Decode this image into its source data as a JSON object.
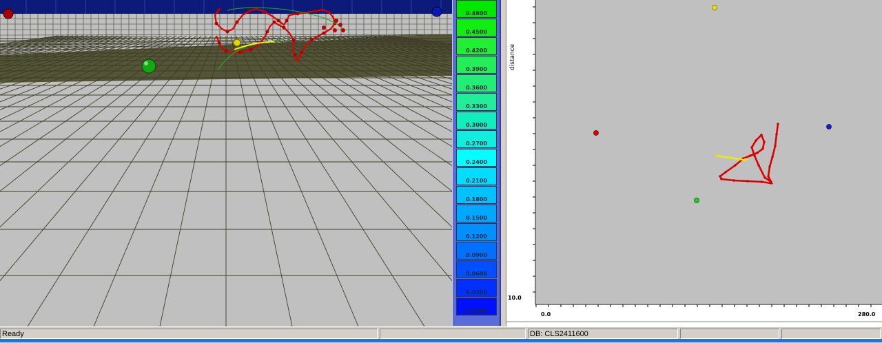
{
  "colors": {
    "sky": "#0c1a7a",
    "floor": "#c0c0c0",
    "back_floor": "#545437",
    "grid": "#3d3d28",
    "track_red": "#dd0000",
    "track_yellow": "#f2f200",
    "track_green": "#22aa22",
    "plot_bg": "#c0c0c0"
  },
  "color_scale": {
    "labels": [
      "0.4800",
      "0.4500",
      "0.4200",
      "0.3900",
      "0.3600",
      "0.3300",
      "0.3000",
      "0.2700",
      "0.2400",
      "0.2100",
      "0.1800",
      "0.1500",
      "0.1200",
      "0.0900",
      "0.0600",
      "0.0300",
      "0.0000"
    ],
    "colors": [
      "#00e800",
      "#11ee11",
      "#22ee33",
      "#22ee55",
      "#22ee77",
      "#22ee99",
      "#11eebb",
      "#11eedd",
      "#00ffff",
      "#00ddff",
      "#00c2ff",
      "#00a8ff",
      "#0090ff",
      "#0070ff",
      "#0050ff",
      "#0030ff",
      "#0010ff"
    ]
  },
  "plot2d": {
    "ylabel": "distance",
    "y_tick": "10.0",
    "x_min_label": "0.0",
    "x_max_label": "280.0"
  },
  "status": {
    "ready": "Ready",
    "db": "DB: CLS2411600"
  }
}
